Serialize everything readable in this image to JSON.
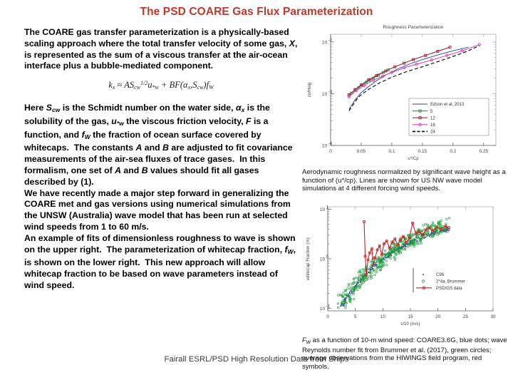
{
  "slide": {
    "title": "The PSD COARE Gas Flux Parameterization",
    "footer": "Fairall ESRL/PSD High Resolution Data from Ships"
  },
  "body": {
    "p1": "The COARE gas transfer parameterization is a physically-based scaling approach where the total transfer velocity of some gas, X, is represented as the sum of a viscous transfer at the air-ocean interface plus a bubble-mediated component.",
    "equation_plain": "k_x ≈ A S_cw^(1/2) u_*w + B F(a_x , S_cw) f_W",
    "p2": "Here S_cw is the Schmidt number on the water side, α_x is the solubility of the gas, u_*w the viscous friction velocity, F is a function, and f_W the fraction of ocean surface covered by whitecaps.  The constants A and B are adjusted to fit covariance measurements of the air-sea fluxes of trace gases.  In this formalism, one set of A and B values should fit all gases described by (1).",
    "p3": "We have recently made a major step forward in generalizing the COARE met and gas versions using numerical simulations from the UNSW (Australia) wave model that has been run at selected wind speeds from 1 to 60 m/s.",
    "p4": "An example of fits of dimensionless roughness to wave is shown on the upper right.  The parameterization of whitecap fraction, f_W, is shown on the lower right.  This new approach will allow whitecap fraction to be based on wave parameters instead of wind speed."
  },
  "captions": {
    "top": "Aerodynamic roughness normalized by significant wave height as a function of (u*/cp). Lines are shown for US NW wave model simulations at 4 different forcing wind speeds.",
    "bottom_lead": "F",
    "bottom_sub": "w",
    "bottom_rest": " as a function of 10-m wind speed: COARE3.6G, blue dots; wave Reynolds number fit from Brummer et al. (2017), green circles; average observations from the HIWINGS field program, red symbols."
  },
  "chart_data": [
    {
      "id": "roughness",
      "type": "line",
      "title": "Roughness Parameterization",
      "xlabel": "u*/Cp",
      "ylabel": "zo/Hsig",
      "xticks": [
        "0",
        "0.05",
        "0.1",
        "0.15",
        "0.2",
        "0.25"
      ],
      "xtickvals": [
        0,
        0.05,
        0.1,
        0.15,
        0.2,
        0.25
      ],
      "yticks": [
        "10-2",
        "10-3",
        "10-4"
      ],
      "ytickvals": [
        -2,
        -3,
        -4
      ],
      "xlim": [
        0,
        0.27
      ],
      "ylim": [
        -4,
        -1.85
      ],
      "grid": false,
      "legend_position": "center-right",
      "legend": [
        {
          "name": "Edson et al. 2013",
          "color": "#2b3fa0",
          "marker": "none",
          "style": "solid"
        },
        {
          "name": "5",
          "color": "#1f9b3c",
          "marker": "square",
          "style": "solid"
        },
        {
          "name": "12",
          "color": "#a3273b",
          "marker": "square",
          "style": "solid"
        },
        {
          "name": "18",
          "color": "#d648b8",
          "marker": "circle",
          "style": "solid"
        },
        {
          "name": "24",
          "color": "#000000",
          "marker": "none",
          "style": "dashed"
        }
      ],
      "series": [
        {
          "name": "Edson et al. 2013",
          "color": "#2b3fa0",
          "x": [
            0.03,
            0.04,
            0.05,
            0.06,
            0.075,
            0.09,
            0.11,
            0.13,
            0.15,
            0.175,
            0.2,
            0.225
          ],
          "y": [
            -3.3,
            -3.12,
            -2.98,
            -2.88,
            -2.75,
            -2.64,
            -2.52,
            -2.42,
            -2.34,
            -2.25,
            -2.17,
            -2.1
          ]
        },
        {
          "name": "5",
          "color": "#1f9b3c",
          "x": [
            0.03,
            0.034,
            0.04,
            0.046,
            0.052,
            0.058,
            0.064,
            0.07,
            0.078,
            0.086,
            0.094
          ],
          "y": [
            -3.02,
            -2.99,
            -2.93,
            -2.88,
            -2.83,
            -2.78,
            -2.74,
            -2.7,
            -2.64,
            -2.59,
            -2.54
          ]
        },
        {
          "name": "12",
          "color": "#a3273b",
          "x": [
            0.03,
            0.04,
            0.05,
            0.062,
            0.075,
            0.09,
            0.105,
            0.12,
            0.135,
            0.155,
            0.175,
            0.195
          ],
          "y": [
            -3.03,
            -2.92,
            -2.83,
            -2.73,
            -2.65,
            -2.56,
            -2.48,
            -2.41,
            -2.34,
            -2.26,
            -2.18,
            -2.1
          ]
        },
        {
          "name": "18",
          "color": "#d648b8",
          "x": [
            0.03,
            0.042,
            0.055,
            0.07,
            0.085,
            0.1,
            0.12,
            0.14,
            0.165,
            0.19,
            0.215,
            0.243
          ],
          "y": [
            -3.06,
            -2.94,
            -2.84,
            -2.74,
            -2.66,
            -2.59,
            -2.5,
            -2.43,
            -2.35,
            -2.26,
            -2.17,
            -2.05
          ]
        },
        {
          "name": "24",
          "color": "#000000",
          "x": [
            0.03,
            0.045,
            0.06,
            0.08,
            0.1,
            0.125,
            0.15,
            0.175,
            0.2,
            0.225,
            0.243
          ],
          "y": [
            -3.33,
            -3.07,
            -2.93,
            -2.79,
            -2.68,
            -2.57,
            -2.48,
            -2.38,
            -2.28,
            -2.17,
            -2.07
          ]
        }
      ]
    },
    {
      "id": "whitecap",
      "type": "scatter",
      "title": "",
      "xlabel": "U10 (m/s)",
      "ylabel": "whitecap Fraction (%)",
      "xticks": [
        "0",
        "5",
        "10",
        "15",
        "20",
        "25",
        "30"
      ],
      "xtickvals": [
        0,
        5,
        10,
        15,
        20,
        25,
        30
      ],
      "yticks": [
        "10-1",
        "10-0",
        "10-1"
      ],
      "ytickvals": [
        -1,
        0,
        1
      ],
      "xlim": [
        0,
        30
      ],
      "ylim": [
        -1.05,
        1.05
      ],
      "grid": false,
      "legend_position": "center-right",
      "legend": [
        {
          "name": "C96",
          "color": "#2b3fa0",
          "marker": "dot"
        },
        {
          "name": "2*4a, Brummer",
          "color": "#1f9b3c",
          "marker": "circle"
        },
        {
          "name": "PSD/GS data",
          "color": "#cc2020",
          "marker": "circle-line"
        }
      ],
      "series": [
        {
          "name": "C96",
          "color": "#2b3fa0",
          "x": [
            2.5,
            3.2,
            4.0,
            4.8,
            5.6,
            6.4,
            7.2,
            8.0,
            8.8,
            9.6,
            10.4,
            11.2,
            12.0,
            12.8,
            13.6,
            14.4,
            15.2,
            16.0,
            17.0,
            18.0,
            19.0,
            20.0,
            21.0,
            22.0
          ],
          "y": [
            -0.95,
            -0.82,
            -0.7,
            -0.58,
            -0.47,
            -0.37,
            -0.28,
            -0.19,
            -0.11,
            -0.04,
            0.03,
            0.09,
            0.15,
            0.2,
            0.25,
            0.3,
            0.34,
            0.38,
            0.43,
            0.47,
            0.51,
            0.54,
            0.57,
            0.6
          ]
        },
        {
          "name": "2*4a, Brummer",
          "color": "#1f9b3c",
          "x": [
            2.5,
            3.5,
            4.5,
            5.5,
            6.5,
            7.5,
            8.5,
            9.5,
            10.5,
            11.5,
            12.5,
            13.5,
            14.5,
            15.5,
            16.5,
            17.5,
            18.5,
            19.5,
            20.5,
            21.5
          ],
          "y": [
            -0.88,
            -0.74,
            -0.6,
            -0.48,
            -0.36,
            -0.25,
            -0.15,
            -0.05,
            0.04,
            0.12,
            0.2,
            0.27,
            0.33,
            0.4,
            0.45,
            0.51,
            0.56,
            0.6,
            0.64,
            0.68
          ]
        },
        {
          "name": "PSD/GS data",
          "color": "#cc2020",
          "x": [
            6.6,
            6.8,
            7.0,
            7.3,
            7.6,
            8.0,
            8.3,
            8.6,
            9.0,
            9.4,
            9.8,
            10.2,
            10.7,
            11.2,
            11.7,
            12.2,
            12.7,
            13.2,
            13.7,
            14.2,
            14.8,
            15.4,
            16.0,
            16.6,
            17.2,
            17.8,
            18.4,
            19.0,
            19.8,
            20.6,
            21.4,
            22.0
          ],
          "y": [
            0.75,
            0.05,
            -0.32,
            -0.02,
            0.12,
            0.2,
            -0.13,
            0.02,
            0.18,
            0.26,
            0.08,
            0.3,
            0.36,
            0.22,
            0.34,
            0.4,
            0.28,
            0.38,
            0.45,
            0.33,
            0.42,
            0.72,
            0.5,
            0.55,
            0.48,
            0.58,
            0.62,
            0.56,
            0.64,
            0.6,
            0.66,
            0.63
          ]
        }
      ]
    }
  ]
}
